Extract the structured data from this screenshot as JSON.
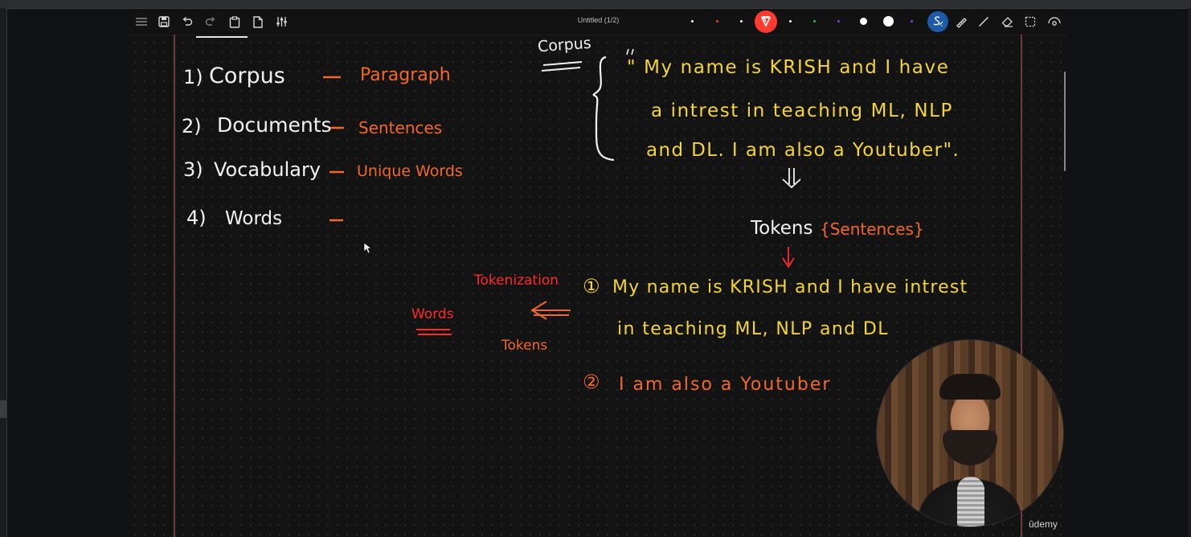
{
  "window": {
    "document_title": "Untitled (1/2)"
  },
  "toolbar": {
    "left_icons": [
      "menu-icon",
      "save-icon",
      "undo-icon",
      "redo-icon",
      "clipboard-icon",
      "new-page-icon",
      "settings-sliders-icon"
    ],
    "right_icons": [
      "pen-icon",
      "ruler-icon",
      "line-icon",
      "eraser-icon",
      "select-icon",
      "view-icon"
    ],
    "colors": {
      "pen_palette": [
        "#ffffff",
        "#ff3b2f",
        "#ffffff",
        "#ff3b2f",
        "#ffffff",
        "#21c44a",
        "#8c38e8",
        "#ffffff",
        "#ffffff",
        "#8c38e8"
      ],
      "active_pen": "#ff3b2f",
      "selected_tool": "#1f5aa8"
    }
  },
  "notes": {
    "list": [
      {
        "number": "1)",
        "term": "Corpus",
        "meaning": "Paragraph"
      },
      {
        "number": "2)",
        "term": "Documents",
        "meaning": "Sentences"
      },
      {
        "number": "3)",
        "term": "Vocabulary",
        "meaning": "Unique Words"
      },
      {
        "number": "4)",
        "term": "Words",
        "meaning": ""
      }
    ],
    "corpus_heading": "Corpus",
    "corpus_text": [
      "\" My name is KRISH and I have",
      "a intrest in teaching ML, NLP",
      "and DL. I am also a Youtuber\"."
    ],
    "tokens_label": "Tokens",
    "tokens_note": "{Sentences}",
    "tokenized": [
      {
        "number": "①",
        "lines": [
          "My name is KRISH and I have intrest",
          "in teaching ML, NLP and DL"
        ]
      },
      {
        "number": "②",
        "lines": [
          "I am also a Youtuber"
        ]
      }
    ],
    "tokenization_label": "Tokenization",
    "words_label": "Words",
    "tokens_small_label": "Tokens"
  },
  "video": {
    "brand": "ûdemy"
  }
}
